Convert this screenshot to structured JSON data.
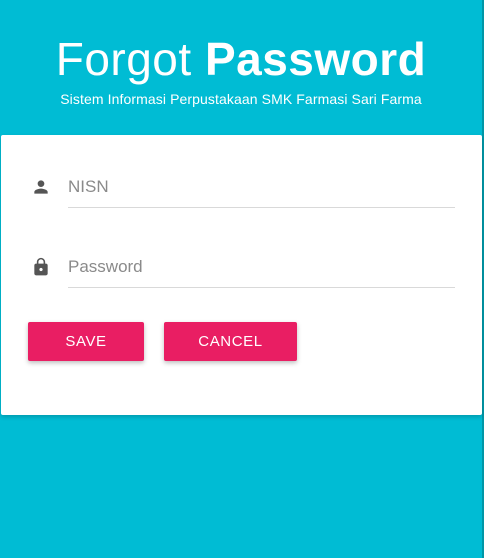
{
  "header": {
    "title_light": "Forgot",
    "title_bold": "Password",
    "subtitle": "Sistem Informasi Perpustakaan SMK Farmasi Sari Farma"
  },
  "form": {
    "nisn": {
      "placeholder": "NISN",
      "value": "",
      "icon": "person-icon"
    },
    "password": {
      "placeholder": "Password",
      "value": "",
      "icon": "lock-icon"
    }
  },
  "buttons": {
    "save_label": "SAVE",
    "cancel_label": "CANCEL"
  },
  "colors": {
    "background": "#00bcd4",
    "button": "#e91e63",
    "card": "#ffffff"
  }
}
